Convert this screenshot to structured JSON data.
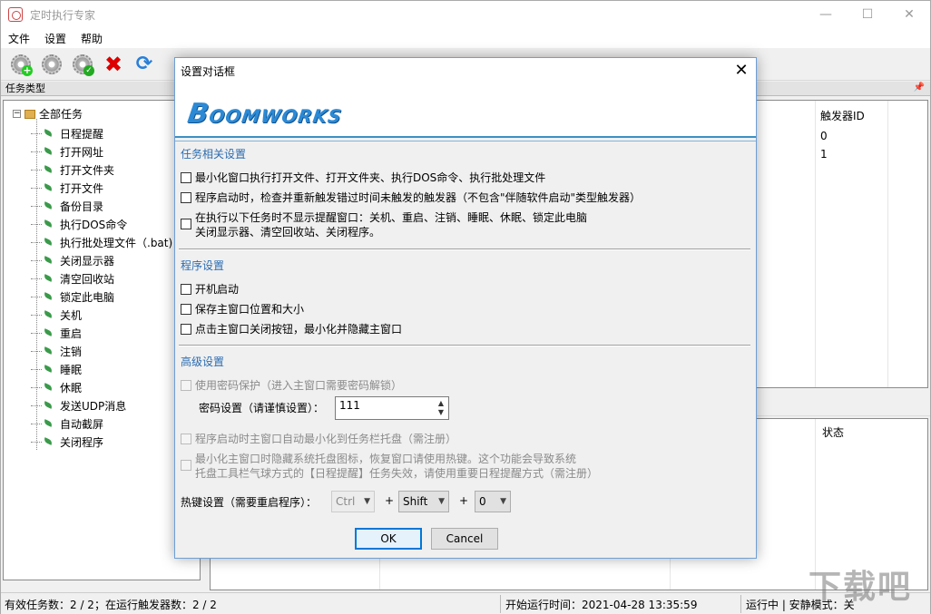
{
  "window": {
    "title": "定时执行专家",
    "controls": {
      "minimize": "—",
      "maximize": "☐",
      "close": "✕"
    }
  },
  "menu": [
    "文件",
    "设置",
    "帮助"
  ],
  "left_panel": {
    "header": "任务类型",
    "root": "全部任务",
    "items": [
      "日程提醒",
      "打开网址",
      "打开文件夹",
      "打开文件",
      "备份目录",
      "执行DOS命令",
      "执行批处理文件（.bat)",
      "关闭显示器",
      "清空回收站",
      "锁定此电脑",
      "关机",
      "重启",
      "注销",
      "睡眠",
      "休眠",
      "发送UDP消息",
      "自动截屏",
      "关闭程序"
    ]
  },
  "trigger_list": {
    "column": "触发器ID",
    "values": [
      "0",
      "1"
    ]
  },
  "log_list": {
    "column": "状态"
  },
  "status_bar": {
    "counts": "有效任务数：2 / 2；在运行触发器数：2 / 2",
    "start_time": "开始运行时间：2021-04-28 13:35:59",
    "mode": "运行中 | 安静模式：关"
  },
  "dialog": {
    "title": "设置对话框",
    "close": "✕",
    "logo_big": "B",
    "logo_rest": "OOMWORKS",
    "sections": {
      "task": {
        "title": "任务相关设置",
        "options": [
          "最小化窗口执行打开文件、打开文件夹、执行DOS命令、执行批处理文件",
          "程序启动时，检查并重新触发错过时间未触发的触发器（不包含\"伴随软件启动\"类型触发器）",
          "在执行以下任务时不显示提醒窗口：关机、重启、注销、睡眠、休眠、锁定此电脑",
          "关闭显示器、清空回收站、关闭程序。"
        ]
      },
      "program": {
        "title": "程序设置",
        "options": [
          "开机启动",
          "保存主窗口位置和大小",
          "点击主窗口关闭按钮，最小化并隐藏主窗口"
        ]
      },
      "advanced": {
        "title": "高级设置",
        "password_protect": "使用密码保护（进入主窗口需要密码解锁）",
        "password_label": "密码设置（请谨慎设置）：",
        "password_value": "111",
        "auto_tray": "程序启动时主窗口自动最小化到任务栏托盘（需注册）",
        "hide_tray_line1": "最小化主窗口时隐藏系统托盘图标，恢复窗口请使用热键。这个功能会导致系统",
        "hide_tray_line2": "托盘工具栏气球方式的【日程提醒】任务失效，请使用重要日程提醒方式（需注册）"
      }
    },
    "hotkey": {
      "label": "热键设置（需要重启程序）：",
      "modifier1": "Ctrl",
      "modifier2": "Shift",
      "key": "0",
      "plus": "+"
    },
    "buttons": {
      "ok": "OK",
      "cancel": "Cancel"
    }
  },
  "watermark": "下载吧",
  "colors": {
    "accent": "#0078d7",
    "section": "#2b6cb0",
    "logo": "#2b8ad6",
    "delete": "#dd0000"
  }
}
